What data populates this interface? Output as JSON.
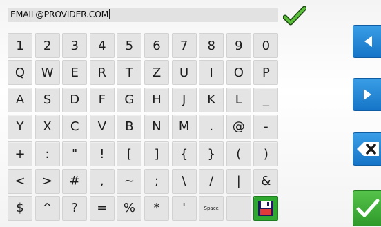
{
  "input": {
    "value": "EMAIL@PROVIDER.COM"
  },
  "keyboard": {
    "rows": [
      [
        "1",
        "2",
        "3",
        "4",
        "5",
        "6",
        "7",
        "8",
        "9",
        "0"
      ],
      [
        "Q",
        "W",
        "E",
        "R",
        "T",
        "Z",
        "U",
        "I",
        "O",
        "P"
      ],
      [
        "A",
        "S",
        "D",
        "F",
        "G",
        "H",
        "J",
        "K",
        "L",
        "_"
      ],
      [
        "Y",
        "X",
        "C",
        "V",
        "B",
        "N",
        "M",
        ".",
        "@",
        "-"
      ],
      [
        "+",
        ":",
        "\"",
        "!",
        "[",
        "]",
        "{",
        "}",
        "(",
        ")"
      ],
      [
        "<",
        ">",
        "#",
        ",",
        "~",
        ";",
        "\\",
        "/",
        "|",
        "&"
      ],
      [
        "$",
        "^",
        "?",
        "=",
        "%",
        "*",
        "'",
        "Space",
        "",
        ""
      ]
    ]
  },
  "icons": {
    "confirm": "checkmark-icon",
    "save": "floppy-disk-icon",
    "cursor_left": "arrow-left-icon",
    "cursor_right": "arrow-right-icon",
    "backspace": "backspace-icon",
    "ok": "checkmark-icon"
  },
  "colors": {
    "blue_button": "#1e86d6",
    "green_button": "#3aa934",
    "key_face": "#e4e4e4",
    "input_field": "#e2e2e2"
  }
}
